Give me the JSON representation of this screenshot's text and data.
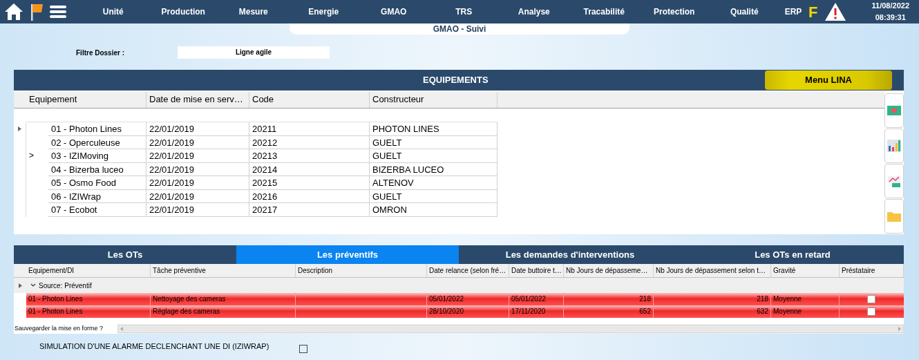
{
  "nav": {
    "items": [
      "Unité",
      "Production",
      "Mesure",
      "Energie",
      "GMAO",
      "TRS",
      "Analyse",
      "Tracabilité",
      "Protection",
      "Qualité",
      "ERP"
    ],
    "flag_letter": "F",
    "date": "11/08/2022",
    "time": "08:39:31"
  },
  "page_title": "GMAO - Suivi",
  "filter": {
    "label": "Filtre Dossier :",
    "value": "Ligne agile"
  },
  "equipment_panel": {
    "title": "EQUIPEMENTS",
    "menu_button": "Menu LINA",
    "columns": [
      "Equipement",
      "Date de mise en serv…",
      "Code",
      "Constructeur"
    ],
    "rows": [
      {
        "current": true,
        "marker": "",
        "cells": [
          "01 - Photon Lines",
          "22/01/2019",
          "20211",
          "PHOTON LINES"
        ]
      },
      {
        "current": false,
        "marker": "",
        "cells": [
          "02 - Operculeuse",
          "22/01/2019",
          "20212",
          "GUELT"
        ]
      },
      {
        "current": false,
        "marker": ">",
        "cells": [
          "03 - IZIMoving",
          "22/01/2019",
          "20213",
          "GUELT"
        ]
      },
      {
        "current": false,
        "marker": "",
        "cells": [
          "04 - Bizerba luceo",
          "22/01/2019",
          "20214",
          "BIZERBA LUCEO"
        ]
      },
      {
        "current": false,
        "marker": "",
        "cells": [
          "05 - Osmo Food",
          "22/01/2019",
          "20215",
          "ALTENOV"
        ]
      },
      {
        "current": false,
        "marker": "",
        "cells": [
          "06 - IZIWrap",
          "22/01/2019",
          "20216",
          "GUELT"
        ]
      },
      {
        "current": false,
        "marker": "",
        "cells": [
          "07 - Ecobot",
          "22/01/2019",
          "20217",
          "OMRON"
        ]
      }
    ]
  },
  "tabs": [
    {
      "label": "Les OTs",
      "selected": false
    },
    {
      "label": "Les préventifs",
      "selected": true
    },
    {
      "label": "Les demandes d'interventions",
      "selected": false
    },
    {
      "label": "Les OTs en retard",
      "selected": false
    }
  ],
  "preventive_grid": {
    "columns": [
      {
        "label": "Equipement/DI",
        "kind": "text"
      },
      {
        "label": "Tâche préventive",
        "kind": "text"
      },
      {
        "label": "Description",
        "kind": "text"
      },
      {
        "label": "Date relance (selon fré…",
        "kind": "text"
      },
      {
        "label": "Date buttoire t…",
        "kind": "text"
      },
      {
        "label": "Nb Jours de dépasseme…",
        "kind": "number"
      },
      {
        "label": "Nb Jours de dépassement selon t…",
        "kind": "number"
      },
      {
        "label": "Gravité",
        "kind": "text"
      },
      {
        "label": "Préstataire",
        "kind": "checkbox"
      }
    ],
    "group": {
      "label": "Source: Préventif",
      "expanded": true,
      "current": true
    },
    "rows": [
      {
        "overdue": true,
        "cells": [
          "01 - Photon Lines",
          "Nettoyage des cameras",
          "",
          "05/01/2022",
          "05/01/2022",
          "218",
          "218",
          "Moyenne"
        ],
        "contractor": false
      },
      {
        "overdue": true,
        "cells": [
          "01 - Photon Lines",
          "Réglage des cameras",
          "",
          "28/10/2020",
          "17/11/2020",
          "652",
          "632",
          "Moyenne"
        ],
        "contractor": false
      }
    ],
    "save_layout_label": "Sauvegarder la mise en forme ?"
  },
  "simulation": {
    "label": "SIMULATION D'UNE ALARME DECLENCHANT UNE DI (IZIWRAP)",
    "checked": false
  }
}
